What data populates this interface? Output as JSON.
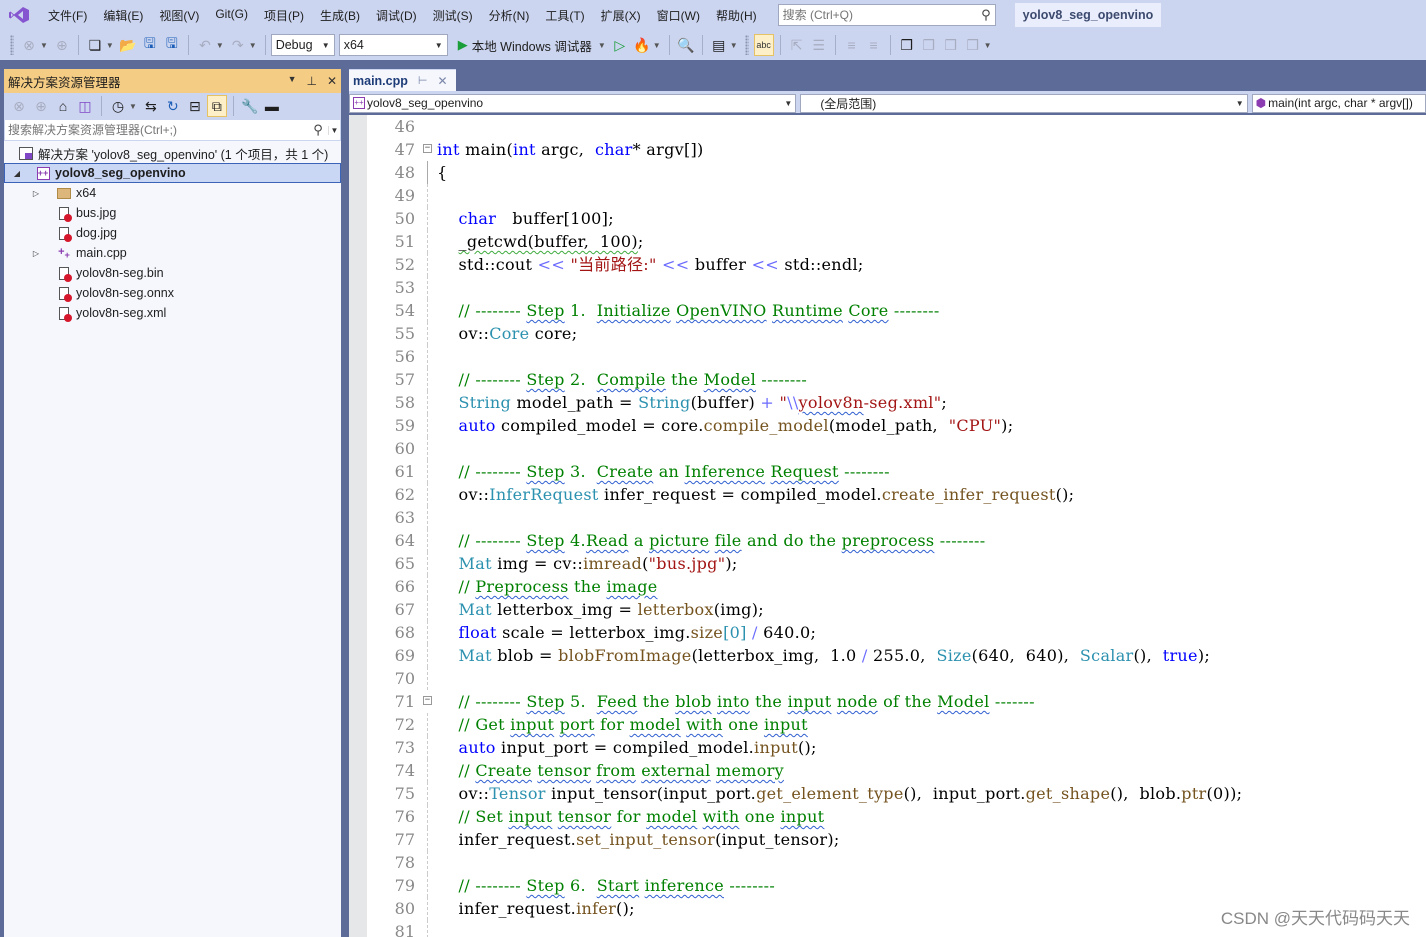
{
  "menubar": {
    "items": [
      "文件(F)",
      "编辑(E)",
      "视图(V)",
      "Git(G)",
      "项目(P)",
      "生成(B)",
      "调试(D)",
      "测试(S)",
      "分析(N)",
      "工具(T)",
      "扩展(X)",
      "窗口(W)",
      "帮助(H)"
    ],
    "search_placeholder": "搜索 (Ctrl+Q)",
    "solution_name": "yolov8_seg_openvino"
  },
  "toolbar": {
    "configuration": "Debug",
    "platform": "x64",
    "run_label": "本地 Windows 调试器"
  },
  "solution_explorer": {
    "title": "解决方案资源管理器",
    "search_placeholder": "搜索解决方案资源管理器(Ctrl+;)",
    "solution_label": "解决方案 'yolov8_seg_openvino' (1 个项目，共 1 个)",
    "project_label": "yolov8_seg_openvino",
    "items": [
      {
        "label": "x64",
        "type": "folder",
        "expandable": true
      },
      {
        "label": "bus.jpg",
        "type": "file",
        "expandable": false
      },
      {
        "label": "dog.jpg",
        "type": "file",
        "expandable": false
      },
      {
        "label": "main.cpp",
        "type": "cpp",
        "expandable": true
      },
      {
        "label": "yolov8n-seg.bin",
        "type": "file",
        "expandable": false
      },
      {
        "label": "yolov8n-seg.onnx",
        "type": "file",
        "expandable": false
      },
      {
        "label": "yolov8n-seg.xml",
        "type": "file",
        "expandable": false
      }
    ]
  },
  "editor": {
    "tab_label": "main.cpp",
    "nav_project": "yolov8_seg_openvino",
    "nav_scope": "(全局范围)",
    "nav_member": "main(int argc, char * argv[])",
    "lines": [
      {
        "n": "46",
        "fold": "none",
        "tokens": []
      },
      {
        "n": "47",
        "fold": "box",
        "tokens": [
          [
            "kw",
            "int"
          ],
          [
            "txt",
            " main("
          ],
          [
            "kw",
            "int"
          ],
          [
            "txt",
            " argc,  "
          ],
          [
            "kw",
            "char"
          ],
          [
            "txt",
            "* argv[])"
          ]
        ]
      },
      {
        "n": "48",
        "fold": "line",
        "tokens": [
          [
            "txt",
            "{"
          ]
        ]
      },
      {
        "n": "49",
        "fold": "dash",
        "tokens": []
      },
      {
        "n": "50",
        "fold": "dash",
        "tokens": [
          [
            "txt",
            "    "
          ],
          [
            "kw",
            "char"
          ],
          [
            "txt",
            "   buffer[100];"
          ]
        ]
      },
      {
        "n": "51",
        "fold": "dash",
        "tokens": [
          [
            "txt",
            "    "
          ],
          [
            "sqg",
            "_getcwd(buffer,  100)"
          ],
          [
            "txt",
            ";"
          ]
        ]
      },
      {
        "n": "52",
        "fold": "dash",
        "tokens": [
          [
            "txt",
            "    std::cout "
          ],
          [
            "op",
            "<<"
          ],
          [
            "txt",
            " "
          ],
          [
            "st",
            "\"当前路径:\""
          ],
          [
            "txt",
            " "
          ],
          [
            "op",
            "<<"
          ],
          [
            "txt",
            " buffer "
          ],
          [
            "op",
            "<<"
          ],
          [
            "txt",
            " std::endl;"
          ]
        ]
      },
      {
        "n": "53",
        "fold": "dash",
        "tokens": []
      },
      {
        "n": "54",
        "fold": "dash",
        "tokens": [
          [
            "txt",
            "    "
          ],
          [
            "cm",
            "// -------- "
          ],
          [
            "cmsq",
            "Step"
          ],
          [
            "cm",
            " 1.  "
          ],
          [
            "cmsq",
            "Initialize"
          ],
          [
            "cm",
            " "
          ],
          [
            "cmsq",
            "OpenVINO"
          ],
          [
            "cm",
            " "
          ],
          [
            "cmsq",
            "Runtime"
          ],
          [
            "cm",
            " "
          ],
          [
            "cmsq",
            "Core"
          ],
          [
            "cm",
            " --------"
          ]
        ]
      },
      {
        "n": "55",
        "fold": "dash",
        "tokens": [
          [
            "txt",
            "    ov::"
          ],
          [
            "ty",
            "Core"
          ],
          [
            "txt",
            " core;"
          ]
        ]
      },
      {
        "n": "56",
        "fold": "dash",
        "tokens": []
      },
      {
        "n": "57",
        "fold": "dash",
        "tokens": [
          [
            "txt",
            "    "
          ],
          [
            "cm",
            "// -------- "
          ],
          [
            "cmsq",
            "Step"
          ],
          [
            "cm",
            " 2.  "
          ],
          [
            "cmsq",
            "Compile"
          ],
          [
            "cm",
            " the "
          ],
          [
            "cmsq",
            "Model"
          ],
          [
            "cm",
            " --------"
          ]
        ]
      },
      {
        "n": "58",
        "fold": "dash",
        "tokens": [
          [
            "txt",
            "    "
          ],
          [
            "ty",
            "String"
          ],
          [
            "txt",
            " model_path = "
          ],
          [
            "ty",
            "String"
          ],
          [
            "txt",
            "(buffer) "
          ],
          [
            "op",
            "+"
          ],
          [
            "txt",
            " "
          ],
          [
            "st",
            "\""
          ],
          [
            "op",
            "\\\\"
          ],
          [
            "stsq",
            "yolov8n"
          ],
          [
            "st",
            "-seg.xml\""
          ],
          [
            "txt",
            ";"
          ]
        ]
      },
      {
        "n": "59",
        "fold": "dash",
        "tokens": [
          [
            "txt",
            "    "
          ],
          [
            "kw",
            "auto"
          ],
          [
            "txt",
            " compiled_model = core."
          ],
          [
            "fn",
            "compile_model"
          ],
          [
            "txt",
            "(model_path,  "
          ],
          [
            "st",
            "\"CPU\""
          ],
          [
            "txt",
            ");"
          ]
        ]
      },
      {
        "n": "60",
        "fold": "dash",
        "tokens": []
      },
      {
        "n": "61",
        "fold": "dash",
        "tokens": [
          [
            "txt",
            "    "
          ],
          [
            "cm",
            "// -------- "
          ],
          [
            "cmsq",
            "Step"
          ],
          [
            "cm",
            " 3.  "
          ],
          [
            "cmsq",
            "Create"
          ],
          [
            "cm",
            " an "
          ],
          [
            "cmsq",
            "Inference"
          ],
          [
            "cm",
            " "
          ],
          [
            "cmsq",
            "Request"
          ],
          [
            "cm",
            " --------"
          ]
        ]
      },
      {
        "n": "62",
        "fold": "dash",
        "tokens": [
          [
            "txt",
            "    ov::"
          ],
          [
            "ty",
            "InferRequest"
          ],
          [
            "txt",
            " infer_request = compiled_model."
          ],
          [
            "fn",
            "create_infer_request"
          ],
          [
            "txt",
            "();"
          ]
        ]
      },
      {
        "n": "63",
        "fold": "dash",
        "tokens": []
      },
      {
        "n": "64",
        "fold": "dash",
        "tokens": [
          [
            "txt",
            "    "
          ],
          [
            "cm",
            "// -------- "
          ],
          [
            "cmsq",
            "Step"
          ],
          [
            "cm",
            " 4."
          ],
          [
            "cmsq",
            "Read"
          ],
          [
            "cm",
            " a "
          ],
          [
            "cmsq",
            "picture"
          ],
          [
            "cm",
            " "
          ],
          [
            "cmsq",
            "file"
          ],
          [
            "cm",
            " and do the "
          ],
          [
            "cmsq",
            "preprocess"
          ],
          [
            "cm",
            " --------"
          ]
        ]
      },
      {
        "n": "65",
        "fold": "dash",
        "tokens": [
          [
            "txt",
            "    "
          ],
          [
            "ty",
            "Mat"
          ],
          [
            "txt",
            " img = cv::"
          ],
          [
            "fn",
            "imread"
          ],
          [
            "txt",
            "("
          ],
          [
            "st",
            "\"bus.jpg\""
          ],
          [
            "txt",
            ");"
          ]
        ]
      },
      {
        "n": "66",
        "fold": "dash",
        "tokens": [
          [
            "txt",
            "    "
          ],
          [
            "cm",
            "// "
          ],
          [
            "cmsq",
            "Preprocess"
          ],
          [
            "cm",
            " the "
          ],
          [
            "cmsq",
            "image"
          ]
        ]
      },
      {
        "n": "67",
        "fold": "dash",
        "tokens": [
          [
            "txt",
            "    "
          ],
          [
            "ty",
            "Mat"
          ],
          [
            "txt",
            " letterbox_img = "
          ],
          [
            "fn",
            "letterbox"
          ],
          [
            "txt",
            "(img);"
          ]
        ]
      },
      {
        "n": "68",
        "fold": "dash",
        "tokens": [
          [
            "txt",
            "    "
          ],
          [
            "kw",
            "float"
          ],
          [
            "txt",
            " scale = letterbox_img."
          ],
          [
            "fn",
            "size"
          ],
          [
            "ty",
            "[0]"
          ],
          [
            "txt",
            " "
          ],
          [
            "op",
            "/"
          ],
          [
            "txt",
            " 640.0;"
          ]
        ]
      },
      {
        "n": "69",
        "fold": "dash",
        "tokens": [
          [
            "txt",
            "    "
          ],
          [
            "ty",
            "Mat"
          ],
          [
            "txt",
            " blob = "
          ],
          [
            "fn",
            "blobFromImage"
          ],
          [
            "txt",
            "(letterbox_img,  1.0 "
          ],
          [
            "op",
            "/"
          ],
          [
            "txt",
            " 255.0,  "
          ],
          [
            "ty",
            "Size"
          ],
          [
            "txt",
            "(640,  640),  "
          ],
          [
            "ty",
            "Scalar"
          ],
          [
            "txt",
            "(),  "
          ],
          [
            "kw",
            "true"
          ],
          [
            "txt",
            ");"
          ]
        ]
      },
      {
        "n": "70",
        "fold": "dash",
        "tokens": []
      },
      {
        "n": "71",
        "fold": "box",
        "tokens": [
          [
            "txt",
            "    "
          ],
          [
            "cm",
            "// -------- "
          ],
          [
            "cmsq",
            "Step"
          ],
          [
            "cm",
            " 5.  "
          ],
          [
            "cmsq",
            "Feed"
          ],
          [
            "cm",
            " the "
          ],
          [
            "cmsq",
            "blob"
          ],
          [
            "cm",
            " "
          ],
          [
            "cmsq",
            "into"
          ],
          [
            "cm",
            " the "
          ],
          [
            "cmsq",
            "input"
          ],
          [
            "cm",
            " "
          ],
          [
            "cmsq",
            "node"
          ],
          [
            "cm",
            " of the "
          ],
          [
            "cmsq",
            "Model"
          ],
          [
            "cm",
            " -------"
          ]
        ]
      },
      {
        "n": "72",
        "fold": "dash",
        "tokens": [
          [
            "txt",
            "    "
          ],
          [
            "cm",
            "// Get "
          ],
          [
            "cmsq",
            "input"
          ],
          [
            "cm",
            " "
          ],
          [
            "cmsq",
            "port"
          ],
          [
            "cm",
            " for "
          ],
          [
            "cmsq",
            "model"
          ],
          [
            "cm",
            " "
          ],
          [
            "cmsq",
            "with"
          ],
          [
            "cm",
            " one "
          ],
          [
            "cmsq",
            "input"
          ]
        ]
      },
      {
        "n": "73",
        "fold": "dash",
        "tokens": [
          [
            "txt",
            "    "
          ],
          [
            "kw",
            "auto"
          ],
          [
            "txt",
            " input_port = compiled_model."
          ],
          [
            "fn",
            "input"
          ],
          [
            "txt",
            "();"
          ]
        ]
      },
      {
        "n": "74",
        "fold": "dash",
        "tokens": [
          [
            "txt",
            "    "
          ],
          [
            "cm",
            "// "
          ],
          [
            "cmsq",
            "Create"
          ],
          [
            "cm",
            " "
          ],
          [
            "cmsq",
            "tensor"
          ],
          [
            "cm",
            " "
          ],
          [
            "cmsq",
            "from"
          ],
          [
            "cm",
            " "
          ],
          [
            "cmsq",
            "external"
          ],
          [
            "cm",
            " "
          ],
          [
            "cmsq",
            "memory"
          ]
        ]
      },
      {
        "n": "75",
        "fold": "dash",
        "tokens": [
          [
            "txt",
            "    ov::"
          ],
          [
            "ty",
            "Tensor"
          ],
          [
            "txt",
            " input_tensor(input_port."
          ],
          [
            "fn",
            "get_element_type"
          ],
          [
            "txt",
            "(),  input_port."
          ],
          [
            "fn",
            "get_shape"
          ],
          [
            "txt",
            "(),  blob."
          ],
          [
            "fn",
            "ptr"
          ],
          [
            "txt",
            "(0));"
          ]
        ]
      },
      {
        "n": "76",
        "fold": "dash",
        "tokens": [
          [
            "txt",
            "    "
          ],
          [
            "cm",
            "// Set "
          ],
          [
            "cmsq",
            "input"
          ],
          [
            "cm",
            " "
          ],
          [
            "cmsq",
            "tensor"
          ],
          [
            "cm",
            " for "
          ],
          [
            "cmsq",
            "model"
          ],
          [
            "cm",
            " "
          ],
          [
            "cmsq",
            "with"
          ],
          [
            "cm",
            " one "
          ],
          [
            "cmsq",
            "input"
          ]
        ]
      },
      {
        "n": "77",
        "fold": "dash",
        "tokens": [
          [
            "txt",
            "    infer_request."
          ],
          [
            "fn",
            "set_input_tensor"
          ],
          [
            "txt",
            "(input_tensor);"
          ]
        ]
      },
      {
        "n": "78",
        "fold": "dash",
        "tokens": []
      },
      {
        "n": "79",
        "fold": "dash",
        "tokens": [
          [
            "txt",
            "    "
          ],
          [
            "cm",
            "// -------- "
          ],
          [
            "cmsq",
            "Step"
          ],
          [
            "cm",
            " 6.  "
          ],
          [
            "cmsq",
            "Start"
          ],
          [
            "cm",
            " "
          ],
          [
            "cmsq",
            "inference"
          ],
          [
            "cm",
            " --------"
          ]
        ]
      },
      {
        "n": "80",
        "fold": "dash",
        "tokens": [
          [
            "txt",
            "    infer_request."
          ],
          [
            "fn",
            "infer"
          ],
          [
            "txt",
            "();"
          ]
        ]
      },
      {
        "n": "81",
        "fold": "dash",
        "tokens": []
      }
    ]
  },
  "watermark": "CSDN @天天代码码天天"
}
